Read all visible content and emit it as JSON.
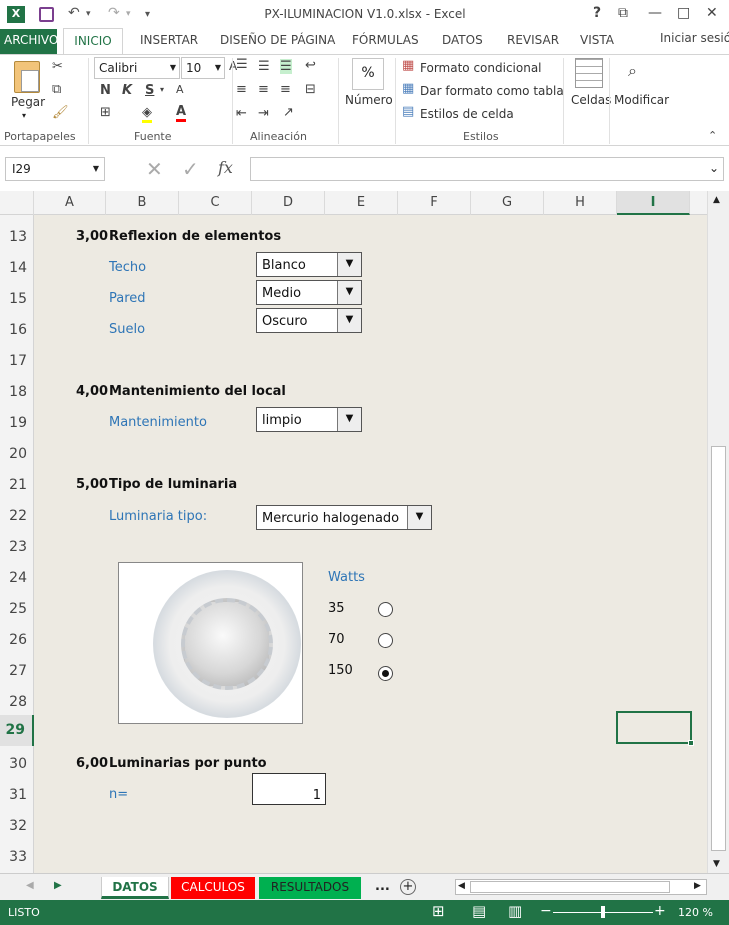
{
  "window": {
    "title": "PX-ILUMINACION V1.0.xlsx - Excel",
    "help": "?",
    "restore": "⧉",
    "minimize": "—",
    "maximize": "□",
    "close": "✕"
  },
  "quick_access": {
    "undo": "↶",
    "redo": "↷",
    "more": "▾"
  },
  "ribbon_tabs": [
    "ARCHIVO",
    "INICIO",
    "INSERTAR",
    "DISEÑO DE PÁGINA",
    "FÓRMULAS",
    "DATOS",
    "REVISAR",
    "VISTA"
  ],
  "signin": "Iniciar sesión",
  "ribbon": {
    "clipboard": {
      "paste": "Pegar",
      "group": "Portapapeles"
    },
    "font": {
      "name": "Calibri",
      "size": "10",
      "bold": "N",
      "italic": "K",
      "underline": "S",
      "group": "Fuente"
    },
    "alignment": {
      "group": "Alineación"
    },
    "number": {
      "label": "Número",
      "symbol": "%"
    },
    "styles": {
      "conditional": "Formato condicional",
      "table": "Dar formato como tabla",
      "cell_styles": "Estilos de celda",
      "group": "Estilos"
    },
    "cells": {
      "label": "Celdas"
    },
    "editing": {
      "label": "Modificar"
    }
  },
  "formula_bar": {
    "name_box": "I29",
    "fx": "fx",
    "formula": ""
  },
  "columns": [
    "A",
    "B",
    "C",
    "D",
    "E",
    "F",
    "G",
    "H",
    "I"
  ],
  "rows": [
    "13",
    "14",
    "15",
    "16",
    "17",
    "18",
    "19",
    "20",
    "21",
    "22",
    "23",
    "24",
    "25",
    "26",
    "27",
    "28",
    "29",
    "30",
    "31",
    "32",
    "33"
  ],
  "sheet": {
    "sec3": {
      "num": "3,00",
      "title": "Reflexion de elementos"
    },
    "techo": {
      "label": "Techo",
      "value": "Blanco"
    },
    "pared": {
      "label": "Pared",
      "value": "Medio"
    },
    "suelo": {
      "label": "Suelo",
      "value": "Oscuro"
    },
    "sec4": {
      "num": "4,00",
      "title": "Mantenimiento del local"
    },
    "mant": {
      "label": "Mantenimiento",
      "value": "limpio"
    },
    "sec5": {
      "num": "5,00",
      "title": "Tipo de luminaria"
    },
    "lum": {
      "label": "Luminaria tipo:",
      "value": "Mercurio halogenado"
    },
    "watts": {
      "label": "Watts",
      "options": [
        "35",
        "70",
        "150"
      ],
      "selected": "150"
    },
    "sec6": {
      "num": "6,00",
      "title": "Luminarias por punto"
    },
    "n": {
      "label": "n=",
      "value": "1"
    }
  },
  "sheet_tabs": [
    "DATOS",
    "CALCULOS",
    "RESULTADOS"
  ],
  "sheet_tab_colors": {
    "DATOS": "#ffffff",
    "CALCULOS": "#ff0000",
    "RESULTADOS": "#00b050"
  },
  "more_tabs": "...",
  "status": {
    "ready": "LISTO",
    "zoom": "120 %"
  },
  "colors": {
    "accent": "#217346",
    "label_blue": "#2e75b6",
    "sheet_bg": "#edeae2"
  }
}
